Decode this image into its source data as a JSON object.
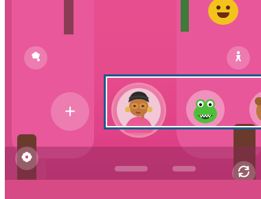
{
  "toolbar": {
    "effects_icon": "effects-icon",
    "person_icon": "person-icon"
  },
  "carousel": {
    "add_label": "+",
    "avatars": [
      {
        "name": "custom-emoji-avatar",
        "selected": true
      },
      {
        "name": "green-dinosaur-avatar",
        "selected": false
      },
      {
        "name": "brown-bear-avatar",
        "selected": false
      }
    ]
  },
  "bottom": {
    "filter_icon": "flower-icon",
    "switch_camera_icon": "camera-switch-icon"
  },
  "colors": {
    "background_pink": "#e54b8c",
    "selection_border": "#1c5a8a",
    "selected_ring": "#f08aa8"
  }
}
